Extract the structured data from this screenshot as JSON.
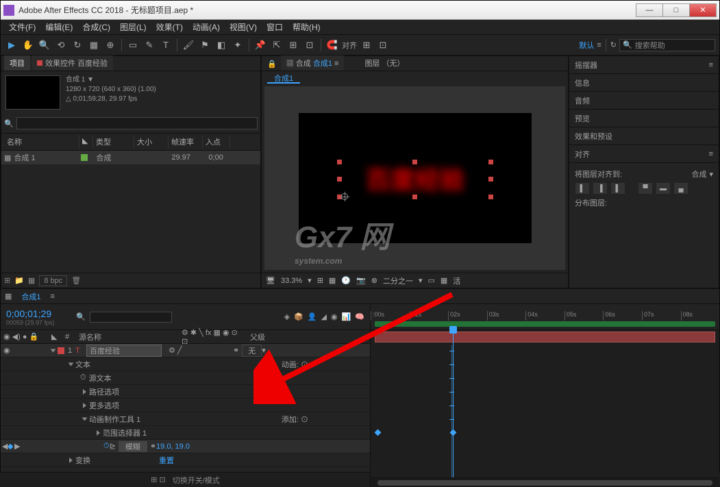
{
  "window": {
    "title": "Adobe After Effects CC 2018 - 无标题项目.aep *"
  },
  "menubar": [
    "文件(F)",
    "编辑(E)",
    "合成(C)",
    "图层(L)",
    "效果(T)",
    "动画(A)",
    "视图(V)",
    "窗口",
    "帮助(H)"
  ],
  "toolbar": {
    "snapping": "对齐",
    "workspace": "默认",
    "search_placeholder": "搜索帮助"
  },
  "project": {
    "tab_project": "项目",
    "tab_effects": "效果控件 百度经验",
    "comp_name": "合成 1",
    "comp_res": "1280 x 720  (640 x 360) (1.00)",
    "comp_dur": "0;01;59;28, 29.97 fps",
    "cols": {
      "name": "名称",
      "type": "类型",
      "size": "大小",
      "fps": "帧速率",
      "in": "入点"
    },
    "row": {
      "name": "合成 1",
      "type": "合成",
      "fps": "29.97",
      "in": "0;00"
    },
    "footer_bpc": "8 bpc"
  },
  "comp_panel": {
    "tab_prefix": "合成",
    "tab_name": "合成1",
    "layer_tab": "图层  （无）",
    "subtab": "合成1",
    "text_content": "百度经验",
    "zoom": "33.3%",
    "res": "二分之一",
    "active_cam": "活"
  },
  "right_panels": {
    "wiggler": "摇摆器",
    "info": "信息",
    "audio": "音频",
    "preview": "预览",
    "effects": "效果和预设",
    "align": "对齐",
    "align_to_label": "将图层对齐到:",
    "align_to_value": "合成",
    "distribute": "分布图层:"
  },
  "timeline": {
    "tab": "合成1",
    "timecode": "0;00;01;29",
    "frames": "00059 (29.97 fps)",
    "col_source": "源名称",
    "col_parent": "父级",
    "layer_num": "1",
    "layer_type": "T",
    "layer_name": "百度经验",
    "parent_none": "无",
    "prop_text": "文本",
    "prop_anim_label": "动画:",
    "prop_source_text": "源文本",
    "prop_path": "路径选项",
    "prop_more": "更多选项",
    "prop_animator": "动画制作工具 1",
    "prop_add": "添加:",
    "prop_range": "范围选择器 1",
    "prop_blur": "模糊",
    "prop_blur_val": "19.0, 19.0",
    "prop_transform": "变换",
    "prop_reset": "重置",
    "footer_switch": "切换开关/模式",
    "ruler_ticks": [
      ":00s",
      "01s",
      "02s",
      "03s",
      "04s",
      "05s",
      "06s",
      "07s",
      "08s"
    ]
  },
  "watermark": {
    "main": "Gx7 网",
    "sub": "system.com"
  }
}
